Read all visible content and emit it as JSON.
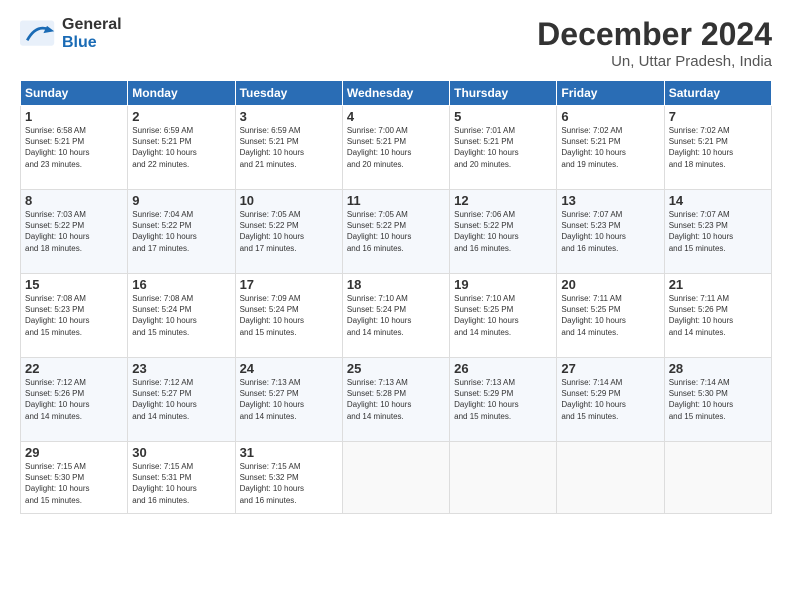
{
  "header": {
    "logo_line1": "General",
    "logo_line2": "Blue",
    "month": "December 2024",
    "location": "Un, Uttar Pradesh, India"
  },
  "days_of_week": [
    "Sunday",
    "Monday",
    "Tuesday",
    "Wednesday",
    "Thursday",
    "Friday",
    "Saturday"
  ],
  "weeks": [
    [
      {
        "num": "1",
        "lines": [
          "Sunrise: 6:58 AM",
          "Sunset: 5:21 PM",
          "Daylight: 10 hours",
          "and 23 minutes."
        ]
      },
      {
        "num": "2",
        "lines": [
          "Sunrise: 6:59 AM",
          "Sunset: 5:21 PM",
          "Daylight: 10 hours",
          "and 22 minutes."
        ]
      },
      {
        "num": "3",
        "lines": [
          "Sunrise: 6:59 AM",
          "Sunset: 5:21 PM",
          "Daylight: 10 hours",
          "and 21 minutes."
        ]
      },
      {
        "num": "4",
        "lines": [
          "Sunrise: 7:00 AM",
          "Sunset: 5:21 PM",
          "Daylight: 10 hours",
          "and 20 minutes."
        ]
      },
      {
        "num": "5",
        "lines": [
          "Sunrise: 7:01 AM",
          "Sunset: 5:21 PM",
          "Daylight: 10 hours",
          "and 20 minutes."
        ]
      },
      {
        "num": "6",
        "lines": [
          "Sunrise: 7:02 AM",
          "Sunset: 5:21 PM",
          "Daylight: 10 hours",
          "and 19 minutes."
        ]
      },
      {
        "num": "7",
        "lines": [
          "Sunrise: 7:02 AM",
          "Sunset: 5:21 PM",
          "Daylight: 10 hours",
          "and 18 minutes."
        ]
      }
    ],
    [
      {
        "num": "8",
        "lines": [
          "Sunrise: 7:03 AM",
          "Sunset: 5:22 PM",
          "Daylight: 10 hours",
          "and 18 minutes."
        ]
      },
      {
        "num": "9",
        "lines": [
          "Sunrise: 7:04 AM",
          "Sunset: 5:22 PM",
          "Daylight: 10 hours",
          "and 17 minutes."
        ]
      },
      {
        "num": "10",
        "lines": [
          "Sunrise: 7:05 AM",
          "Sunset: 5:22 PM",
          "Daylight: 10 hours",
          "and 17 minutes."
        ]
      },
      {
        "num": "11",
        "lines": [
          "Sunrise: 7:05 AM",
          "Sunset: 5:22 PM",
          "Daylight: 10 hours",
          "and 16 minutes."
        ]
      },
      {
        "num": "12",
        "lines": [
          "Sunrise: 7:06 AM",
          "Sunset: 5:22 PM",
          "Daylight: 10 hours",
          "and 16 minutes."
        ]
      },
      {
        "num": "13",
        "lines": [
          "Sunrise: 7:07 AM",
          "Sunset: 5:23 PM",
          "Daylight: 10 hours",
          "and 16 minutes."
        ]
      },
      {
        "num": "14",
        "lines": [
          "Sunrise: 7:07 AM",
          "Sunset: 5:23 PM",
          "Daylight: 10 hours",
          "and 15 minutes."
        ]
      }
    ],
    [
      {
        "num": "15",
        "lines": [
          "Sunrise: 7:08 AM",
          "Sunset: 5:23 PM",
          "Daylight: 10 hours",
          "and 15 minutes."
        ]
      },
      {
        "num": "16",
        "lines": [
          "Sunrise: 7:08 AM",
          "Sunset: 5:24 PM",
          "Daylight: 10 hours",
          "and 15 minutes."
        ]
      },
      {
        "num": "17",
        "lines": [
          "Sunrise: 7:09 AM",
          "Sunset: 5:24 PM",
          "Daylight: 10 hours",
          "and 15 minutes."
        ]
      },
      {
        "num": "18",
        "lines": [
          "Sunrise: 7:10 AM",
          "Sunset: 5:24 PM",
          "Daylight: 10 hours",
          "and 14 minutes."
        ]
      },
      {
        "num": "19",
        "lines": [
          "Sunrise: 7:10 AM",
          "Sunset: 5:25 PM",
          "Daylight: 10 hours",
          "and 14 minutes."
        ]
      },
      {
        "num": "20",
        "lines": [
          "Sunrise: 7:11 AM",
          "Sunset: 5:25 PM",
          "Daylight: 10 hours",
          "and 14 minutes."
        ]
      },
      {
        "num": "21",
        "lines": [
          "Sunrise: 7:11 AM",
          "Sunset: 5:26 PM",
          "Daylight: 10 hours",
          "and 14 minutes."
        ]
      }
    ],
    [
      {
        "num": "22",
        "lines": [
          "Sunrise: 7:12 AM",
          "Sunset: 5:26 PM",
          "Daylight: 10 hours",
          "and 14 minutes."
        ]
      },
      {
        "num": "23",
        "lines": [
          "Sunrise: 7:12 AM",
          "Sunset: 5:27 PM",
          "Daylight: 10 hours",
          "and 14 minutes."
        ]
      },
      {
        "num": "24",
        "lines": [
          "Sunrise: 7:13 AM",
          "Sunset: 5:27 PM",
          "Daylight: 10 hours",
          "and 14 minutes."
        ]
      },
      {
        "num": "25",
        "lines": [
          "Sunrise: 7:13 AM",
          "Sunset: 5:28 PM",
          "Daylight: 10 hours",
          "and 14 minutes."
        ]
      },
      {
        "num": "26",
        "lines": [
          "Sunrise: 7:13 AM",
          "Sunset: 5:29 PM",
          "Daylight: 10 hours",
          "and 15 minutes."
        ]
      },
      {
        "num": "27",
        "lines": [
          "Sunrise: 7:14 AM",
          "Sunset: 5:29 PM",
          "Daylight: 10 hours",
          "and 15 minutes."
        ]
      },
      {
        "num": "28",
        "lines": [
          "Sunrise: 7:14 AM",
          "Sunset: 5:30 PM",
          "Daylight: 10 hours",
          "and 15 minutes."
        ]
      }
    ],
    [
      {
        "num": "29",
        "lines": [
          "Sunrise: 7:15 AM",
          "Sunset: 5:30 PM",
          "Daylight: 10 hours",
          "and 15 minutes."
        ]
      },
      {
        "num": "30",
        "lines": [
          "Sunrise: 7:15 AM",
          "Sunset: 5:31 PM",
          "Daylight: 10 hours",
          "and 16 minutes."
        ]
      },
      {
        "num": "31",
        "lines": [
          "Sunrise: 7:15 AM",
          "Sunset: 5:32 PM",
          "Daylight: 10 hours",
          "and 16 minutes."
        ]
      },
      null,
      null,
      null,
      null
    ]
  ]
}
